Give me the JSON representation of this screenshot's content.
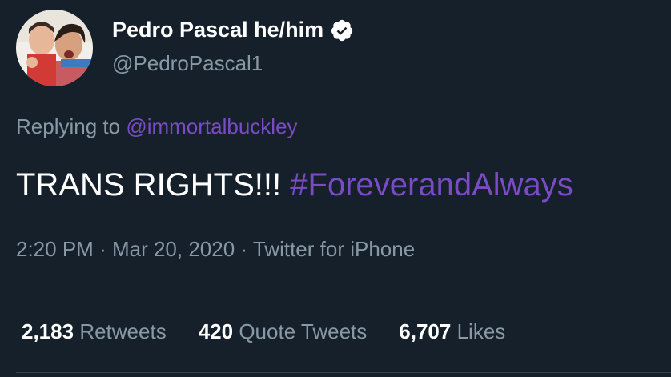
{
  "user": {
    "display_name": "Pedro Pascal he/him",
    "handle": "@PedroPascal1",
    "verified": true
  },
  "reply": {
    "prefix": "Replying to",
    "mention": "@immortalbuckley"
  },
  "tweet": {
    "text": "TRANS RIGHTS!!!",
    "hashtag": "#ForeverandAlways"
  },
  "meta": {
    "time": "2:20 PM",
    "separator": "·",
    "date": "Mar 20, 2020",
    "source": "Twitter for iPhone"
  },
  "stats": [
    {
      "count": "2,183",
      "label": "Retweets"
    },
    {
      "count": "420",
      "label": "Quote Tweets"
    },
    {
      "count": "6,707",
      "label": "Likes"
    }
  ],
  "colors": {
    "background": "#15202b",
    "accent": "#794bc4",
    "muted": "#8899a6",
    "divider": "#38444d"
  },
  "icons": {
    "avatar": "profile-photo",
    "verified": "verified-badge-icon"
  }
}
